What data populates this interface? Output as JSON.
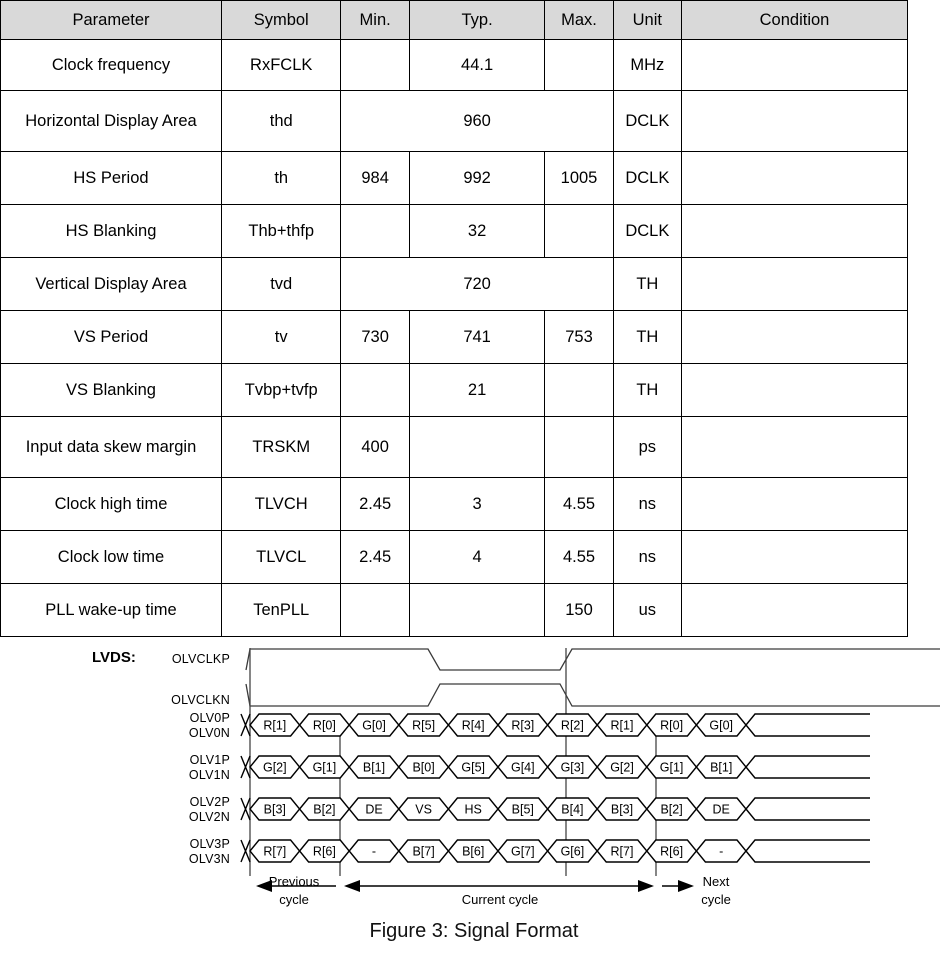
{
  "table": {
    "headers": [
      "Parameter",
      "Symbol",
      "Min.",
      "Typ.",
      "Max.",
      "Unit",
      "Condition"
    ],
    "rows": [
      {
        "parameter": "Clock frequency",
        "symbol": "RxFCLK",
        "min": "",
        "typ": "44.1",
        "max": "",
        "unit": "MHz",
        "condition": "",
        "typ_span": 1
      },
      {
        "parameter": "Horizontal Display Area",
        "symbol": "thd",
        "min": "",
        "typ": "960",
        "max": "",
        "unit": "DCLK",
        "condition": "",
        "typ_span": 3
      },
      {
        "parameter": "HS Period",
        "symbol": "th",
        "min": "984",
        "typ": "992",
        "max": "1005",
        "unit": "DCLK",
        "condition": "",
        "typ_span": 1
      },
      {
        "parameter": "HS Blanking",
        "symbol": "Thb+thfp",
        "min": "",
        "typ": "32",
        "max": "",
        "unit": "DCLK",
        "condition": "",
        "typ_span": 1
      },
      {
        "parameter": "Vertical Display Area",
        "symbol": "tvd",
        "min": "",
        "typ": "720",
        "max": "",
        "unit": "TH",
        "condition": "",
        "typ_span": 3
      },
      {
        "parameter": "VS Period",
        "symbol": "tv",
        "min": "730",
        "typ": "741",
        "max": "753",
        "unit": "TH",
        "condition": "",
        "typ_span": 1
      },
      {
        "parameter": "VS Blanking",
        "symbol": "Tvbp+tvfp",
        "min": "",
        "typ": "21",
        "max": "",
        "unit": "TH",
        "condition": "",
        "typ_span": 1
      },
      {
        "parameter": "Input data skew margin",
        "symbol": "TRSKM",
        "min": "400",
        "typ": "",
        "max": "",
        "unit": "ps",
        "condition": "",
        "typ_span": 1
      },
      {
        "parameter": "Clock high time",
        "symbol": "TLVCH",
        "min": "2.45",
        "typ": "3",
        "max": "4.55",
        "unit": "ns",
        "condition": "",
        "typ_span": 1
      },
      {
        "parameter": "Clock low time",
        "symbol": "TLVCL",
        "min": "2.45",
        "typ": "4",
        "max": "4.55",
        "unit": "ns",
        "condition": "",
        "typ_span": 1
      },
      {
        "parameter": "PLL wake-up time",
        "symbol": "TenPLL",
        "min": "",
        "typ": "",
        "max": "150",
        "unit": "us",
        "condition": "",
        "typ_span": 1
      }
    ]
  },
  "figure": {
    "caption": "Figure 3: Signal Format",
    "group_label": "LVDS:",
    "clock_signals": [
      {
        "name": "OLVCLKP"
      },
      {
        "name": "OLVCLKN"
      }
    ],
    "data_lanes": [
      {
        "name_p": "OLV0P",
        "name_n": "OLV0N",
        "cells": [
          "R[1]",
          "R[0]",
          "G[0]",
          "R[5]",
          "R[4]",
          "R[3]",
          "R[2]",
          "R[1]",
          "R[0]",
          "G[0]"
        ]
      },
      {
        "name_p": "OLV1P",
        "name_n": "OLV1N",
        "cells": [
          "G[2]",
          "G[1]",
          "B[1]",
          "B[0]",
          "G[5]",
          "G[4]",
          "G[3]",
          "G[2]",
          "G[1]",
          "B[1]"
        ]
      },
      {
        "name_p": "OLV2P",
        "name_n": "OLV2N",
        "cells": [
          "B[3]",
          "B[2]",
          "DE",
          "VS",
          "HS",
          "B[5]",
          "B[4]",
          "B[3]",
          "B[2]",
          "DE"
        ]
      },
      {
        "name_p": "OLV3P",
        "name_n": "OLV3N",
        "cells": [
          "R[7]",
          "R[6]",
          "-",
          "B[7]",
          "B[6]",
          "G[7]",
          "G[6]",
          "R[7]",
          "R[6]",
          "-"
        ]
      }
    ],
    "cycle_labels": {
      "previous_line1": "Previous",
      "previous_line2": "cycle",
      "current": "Current cycle",
      "next_line1": "Next",
      "next_line2": "cycle"
    }
  },
  "colors": {
    "header_bg": "#d9d9d9",
    "border": "#000000",
    "wave_stroke": "#3a3a3a",
    "text": "#000000"
  }
}
